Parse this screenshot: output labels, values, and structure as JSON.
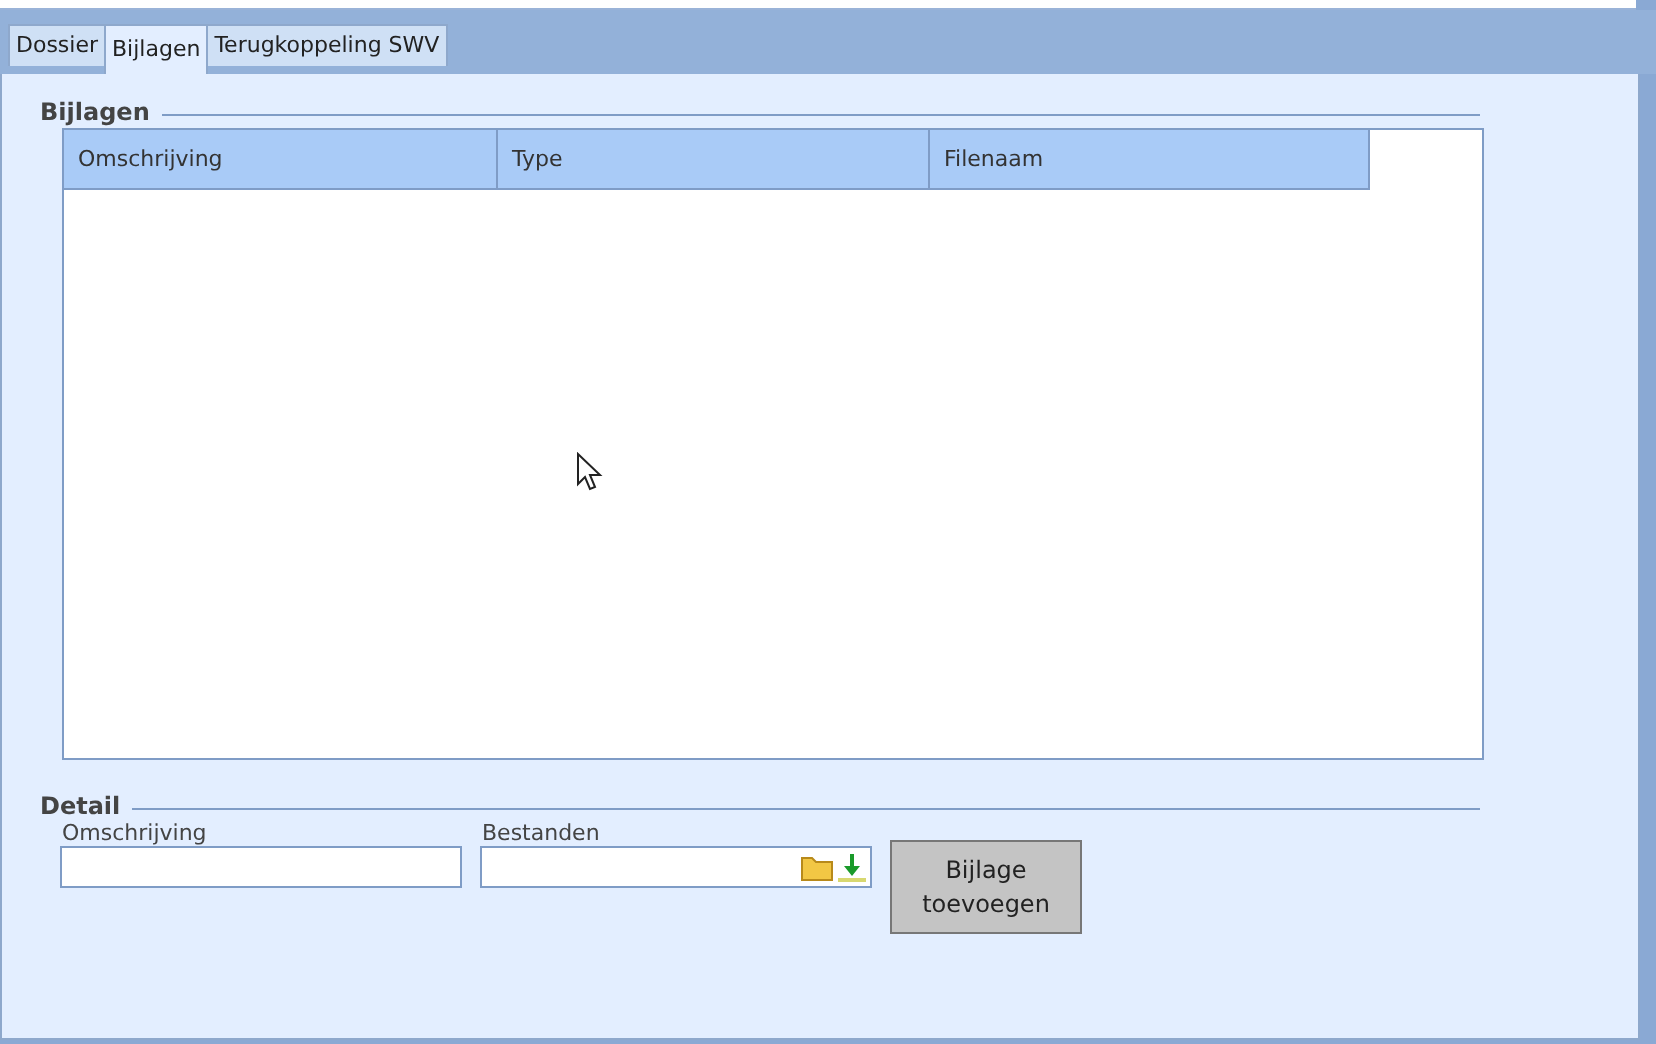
{
  "tabs": [
    {
      "label": "Dossier",
      "selected": false
    },
    {
      "label": "Bijlagen",
      "selected": true
    },
    {
      "label": "Terugkoppeling SWV",
      "selected": false
    }
  ],
  "attachments": {
    "legend": "Bijlagen",
    "columns": [
      "Omschrijving",
      "Type",
      "Filenaam"
    ]
  },
  "detail": {
    "legend": "Detail",
    "description_label": "Omschrijving",
    "files_label": "Bestanden",
    "add_button": "Bijlage toevoegen"
  }
}
